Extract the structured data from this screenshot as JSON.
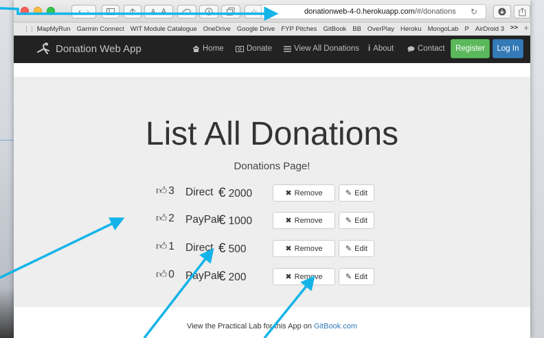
{
  "browser": {
    "url_host": "donationweb-4-0.herokuapp.com",
    "url_path": "/#/donations",
    "bookmarks": [
      "MapMyRun",
      "Garmin Connect",
      "WIT Module Catalogue",
      "OneDrive",
      "Google Drive",
      "FYP Pitches",
      "GitBook",
      "BB",
      "OverPlay",
      "Heroku",
      "MongoLab",
      "P",
      "AirDroid 3"
    ],
    "more_label": ">>",
    "plus_label": "+",
    "font_small": "A",
    "font_large": "A"
  },
  "navbar": {
    "brand": "Donation Web App",
    "links": [
      "Home",
      "Donate",
      "View All Donations",
      "About",
      "Contact"
    ],
    "register_label": "Register",
    "login_label": "Log In"
  },
  "main": {
    "title": "List All Donations",
    "subtitle": "Donations Page!",
    "donations": [
      {
        "upvotes": "3",
        "method": "Direct",
        "currency": "€",
        "amount": "2000"
      },
      {
        "upvotes": "2",
        "method": "PayPal",
        "currency": "€",
        "amount": "1000"
      },
      {
        "upvotes": "1",
        "method": "Direct",
        "currency": "€",
        "amount": "500"
      },
      {
        "upvotes": "0",
        "method": "PayPal",
        "currency": "€",
        "amount": "200"
      }
    ],
    "remove_label": "Remove",
    "edit_label": "Edit"
  },
  "footer": {
    "text": "View the Practical Lab for this App on",
    "link": "GitBook.com"
  },
  "colors": {
    "annotation_arrow": "#14b4e8",
    "register_green": "#5cb85c",
    "login_blue": "#337ab7",
    "navbar_bg": "#222222",
    "jumbotron_bg": "#eeeeee"
  },
  "icons": [
    "sidebar-icon",
    "share-icon",
    "cloud-icon",
    "history-icon",
    "tabs-icon",
    "bookmark-star-icon",
    "reload-icon",
    "download-icon",
    "export-icon",
    "grid-icon",
    "logo-icon",
    "home-icon",
    "donate-icon",
    "list-icon",
    "info-icon",
    "comment-icon",
    "thumbs-up-icon",
    "remove-x-icon",
    "edit-icon"
  ]
}
